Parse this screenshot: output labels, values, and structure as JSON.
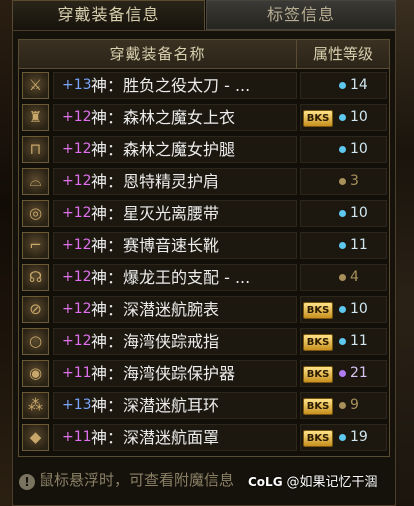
{
  "tabs": [
    {
      "label": "穿戴装备信息",
      "active": true
    },
    {
      "label": "标签信息",
      "active": false
    }
  ],
  "table": {
    "header_name": "穿戴装备名称",
    "header_level": "属性等级",
    "rows": [
      {
        "icon": "weapon-icon",
        "glyph": "⚔",
        "upgrade": "+13",
        "name": "神：胜负之役太刀 - ...",
        "badge": "",
        "level": "14",
        "dot": "#5ec8f0",
        "level_color": "#cfe6f0"
      },
      {
        "icon": "top-icon",
        "glyph": "♜",
        "upgrade": "+12",
        "name": "神：森林之魔女上衣",
        "badge": "BKS",
        "level": "10",
        "dot": "#5ec8f0",
        "level_color": "#cfe6f0"
      },
      {
        "icon": "pants-icon",
        "glyph": "⊓",
        "upgrade": "+12",
        "name": "神：森林之魔女护腿",
        "badge": "",
        "level": "10",
        "dot": "#5ec8f0",
        "level_color": "#cfe6f0"
      },
      {
        "icon": "shoulder-icon",
        "glyph": "⌓",
        "upgrade": "+12",
        "name": "神：恩特精灵护肩",
        "badge": "",
        "level": "3",
        "dot": "#a8905a",
        "level_color": "#a8905a"
      },
      {
        "icon": "belt-icon",
        "glyph": "◎",
        "upgrade": "+12",
        "name": "神：星灭光离腰带",
        "badge": "",
        "level": "10",
        "dot": "#5ec8f0",
        "level_color": "#cfe6f0"
      },
      {
        "icon": "boots-icon",
        "glyph": "⌐",
        "upgrade": "+12",
        "name": "神：赛博音速长靴",
        "badge": "",
        "level": "11",
        "dot": "#5ec8f0",
        "level_color": "#cfe6f0"
      },
      {
        "icon": "necklace-icon",
        "glyph": "☊",
        "upgrade": "+12",
        "name": "神：爆龙王的支配 - ...",
        "badge": "",
        "level": "4",
        "dot": "#a8905a",
        "level_color": "#a8905a"
      },
      {
        "icon": "bracelet-icon",
        "glyph": "⊘",
        "upgrade": "+12",
        "name": "神：深潜迷航腕表",
        "badge": "BKS",
        "level": "10",
        "dot": "#5ec8f0",
        "level_color": "#cfe6f0"
      },
      {
        "icon": "ring-icon",
        "glyph": "○",
        "upgrade": "+12",
        "name": "神：海湾侠踪戒指",
        "badge": "BKS",
        "level": "11",
        "dot": "#5ec8f0",
        "level_color": "#cfe6f0"
      },
      {
        "icon": "support-icon",
        "glyph": "◉",
        "upgrade": "+11",
        "name": "神：海湾侠踪保护器",
        "badge": "BKS",
        "level": "21",
        "dot": "#b07cf0",
        "level_color": "#d8c4f4"
      },
      {
        "icon": "earring-icon",
        "glyph": "⁂",
        "upgrade": "+13",
        "name": "神：深潜迷航耳环",
        "badge": "BKS",
        "level": "9",
        "dot": "#a8905a",
        "level_color": "#a8905a"
      },
      {
        "icon": "mask-icon",
        "glyph": "◆",
        "upgrade": "+11",
        "name": "神：深潜迷航面罩",
        "badge": "BKS",
        "level": "19",
        "dot": "#5ec8f0",
        "level_color": "#cfe6f0"
      }
    ]
  },
  "footer": {
    "icon": "!",
    "text": "鼠标悬浮时，可查看附魔信息"
  },
  "watermark": {
    "logo": "CoLG",
    "text": "@如果记忆干涸"
  },
  "colors": {
    "upgrade_13": "#7aa6ff",
    "upgrade_12": "#e070f0",
    "upgrade_11": "#e070f0",
    "name_text": "#ececec"
  }
}
